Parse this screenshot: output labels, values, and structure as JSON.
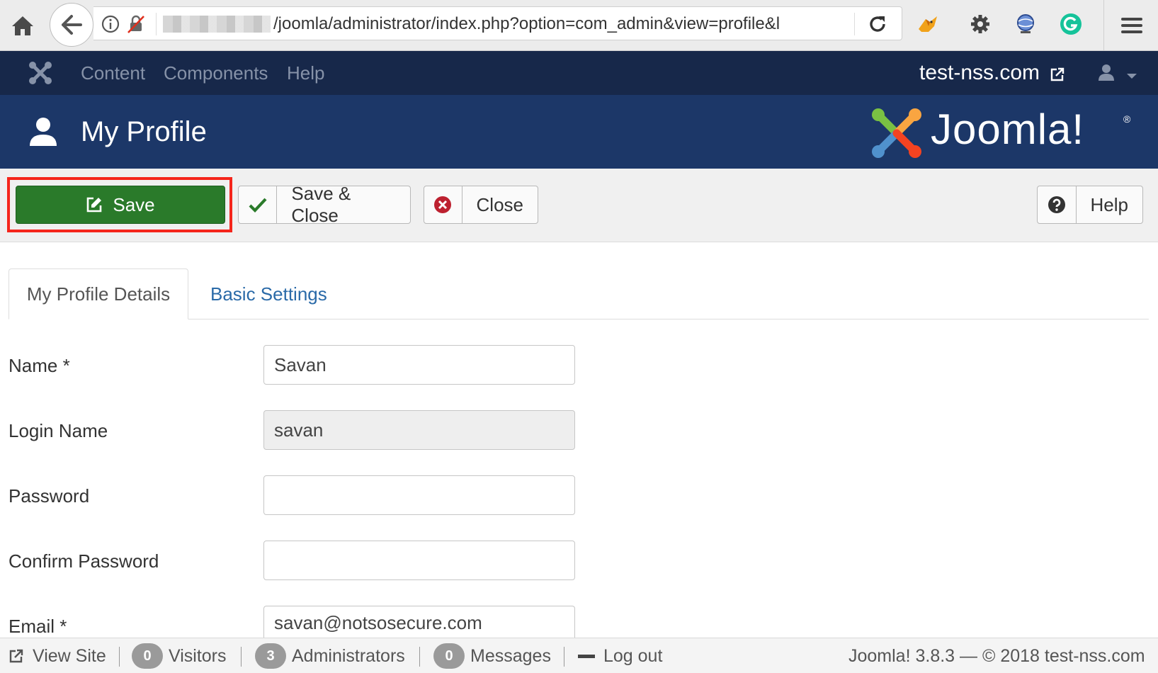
{
  "browser": {
    "url": "/joomla/administrator/index.php?option=com_admin&view=profile&l"
  },
  "topnav": {
    "items": [
      {
        "label": "Content"
      },
      {
        "label": "Components"
      },
      {
        "label": "Help"
      }
    ],
    "site_link": "test-nss.com"
  },
  "header": {
    "title": "My Profile",
    "brand": "Joomla!",
    "brand_mark": "®"
  },
  "toolbar": {
    "save_label": "Save",
    "save_close_label": "Save & Close",
    "close_label": "Close",
    "help_label": "Help"
  },
  "tabs": [
    {
      "label": "My Profile Details",
      "active": true
    },
    {
      "label": "Basic Settings",
      "active": false
    }
  ],
  "form": {
    "name": {
      "label": "Name *",
      "value": "Savan"
    },
    "login_name": {
      "label": "Login Name",
      "value": "savan"
    },
    "password": {
      "label": "Password",
      "value": ""
    },
    "confirm_password": {
      "label": "Confirm Password",
      "value": ""
    },
    "email": {
      "label": "Email *",
      "value": "savan@notsosecure.com"
    }
  },
  "status_bar": {
    "view_site": "View Site",
    "visitors_count": "0",
    "visitors_label": "Visitors",
    "admins_count": "3",
    "admins_label": "Administrators",
    "messages_count": "0",
    "messages_label": "Messages",
    "logout_label": "Log out",
    "version_text": "Joomla! 3.8.3 — © 2018 test-nss.com"
  },
  "colors": {
    "topnav_bg": "#17284a",
    "header_bg": "#1c3768",
    "save_green": "#2a7a2a",
    "highlight_red": "#f5251b",
    "tab_link_blue": "#2a6aa8"
  },
  "icons": [
    "home-icon",
    "back-arrow-icon",
    "info-icon",
    "insecure-lock-icon",
    "reload-icon",
    "fox-extension-icon",
    "gear-icon",
    "globe-extension-icon",
    "grammarly-icon",
    "hamburger-menu-icon",
    "joomla-icon",
    "external-link-icon",
    "user-icon",
    "caret-down-icon",
    "edit-icon",
    "check-icon",
    "close-circle-icon",
    "question-circle-icon",
    "minus-icon"
  ]
}
